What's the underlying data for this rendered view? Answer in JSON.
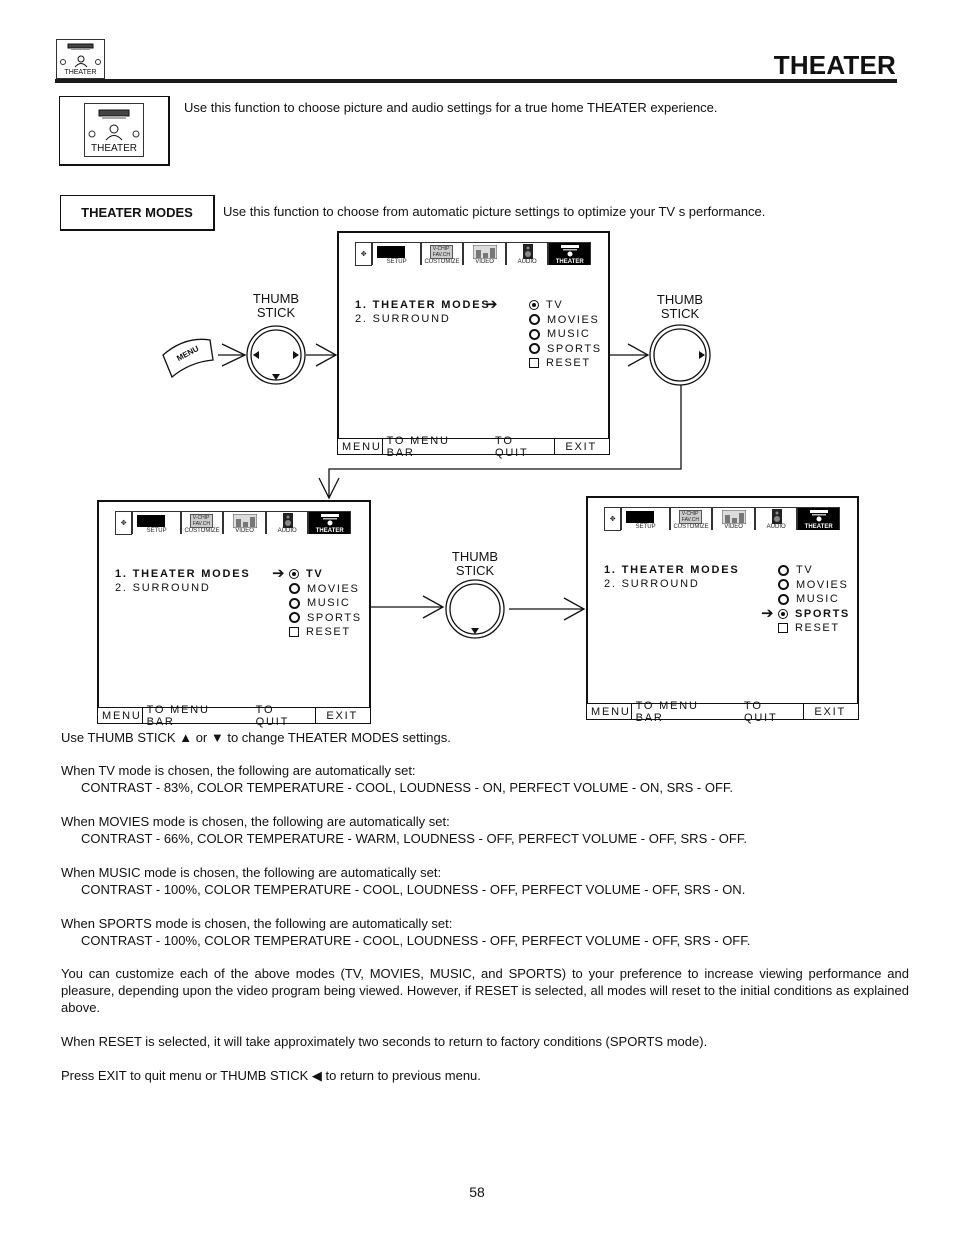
{
  "header": {
    "title": "THEATER",
    "corner_icon_label": "THEATER"
  },
  "intro": {
    "icon_label": "THEATER",
    "text": "Use this function to choose picture and audio settings for a true home THEATER experience."
  },
  "theater_modes": {
    "label": "THEATER MODES",
    "description": "Use this function to choose from automatic picture settings to optimize your TV s performance."
  },
  "diagram": {
    "menu_button_label": "MENU",
    "thumb_stick_label_line1": "THUMB",
    "thumb_stick_label_line2": "STICK",
    "menu_tabs": [
      "SETUP",
      "CUSTOMIZE",
      "VIDEO",
      "AUDIO",
      "THEATER"
    ],
    "customize_tab_lines": [
      "V-CHIP",
      "FAV.CH"
    ],
    "screens": [
      {
        "menu_items": [
          "1. THEATER MODES",
          "2. SURROUND"
        ],
        "options": [
          {
            "label": "TV",
            "type": "radio",
            "selected": true,
            "pointer": false,
            "bold": false
          },
          {
            "label": "MOVIES",
            "type": "radio",
            "selected": false,
            "pointer": false,
            "bold": false
          },
          {
            "label": "MUSIC",
            "type": "radio",
            "selected": false,
            "pointer": false,
            "bold": false
          },
          {
            "label": "SPORTS",
            "type": "radio",
            "selected": false,
            "pointer": false,
            "bold": false
          },
          {
            "label": "RESET",
            "type": "checkbox",
            "selected": false,
            "pointer": false,
            "bold": false
          }
        ],
        "pointer_on": "menu"
      },
      {
        "menu_items": [
          "1. THEATER MODES",
          "2. SURROUND"
        ],
        "options": [
          {
            "label": "TV",
            "type": "radio",
            "selected": true,
            "pointer": true,
            "bold": true
          },
          {
            "label": "MOVIES",
            "type": "radio",
            "selected": false,
            "pointer": false,
            "bold": false
          },
          {
            "label": "MUSIC",
            "type": "radio",
            "selected": false,
            "pointer": false,
            "bold": false
          },
          {
            "label": "SPORTS",
            "type": "radio",
            "selected": false,
            "pointer": false,
            "bold": false
          },
          {
            "label": "RESET",
            "type": "checkbox",
            "selected": false,
            "pointer": false,
            "bold": false
          }
        ],
        "pointer_on": "option"
      },
      {
        "menu_items": [
          "1. THEATER MODES",
          "2. SURROUND"
        ],
        "options": [
          {
            "label": "TV",
            "type": "radio",
            "selected": false,
            "pointer": false,
            "bold": false
          },
          {
            "label": "MOVIES",
            "type": "radio",
            "selected": false,
            "pointer": false,
            "bold": false
          },
          {
            "label": "MUSIC",
            "type": "radio",
            "selected": false,
            "pointer": false,
            "bold": false
          },
          {
            "label": "SPORTS",
            "type": "radio",
            "selected": true,
            "pointer": true,
            "bold": true
          },
          {
            "label": "RESET",
            "type": "checkbox",
            "selected": false,
            "pointer": false,
            "bold": false
          }
        ],
        "pointer_on": "option"
      }
    ],
    "footer": {
      "menu": "MENU",
      "to_menu_bar": "TO MENU BAR",
      "to_quit": "TO QUIT",
      "exit": "EXIT"
    }
  },
  "body": {
    "usage": "Use THUMB STICK ▲ or ▼ to change THEATER MODES settings.",
    "tv_intro": "When TV mode is chosen, the following are automatically set:",
    "tv_settings": "CONTRAST - 83%, COLOR TEMPERATURE - COOL, LOUDNESS - ON, PERFECT VOLUME - ON, SRS - OFF.",
    "movies_intro": "When MOVIES mode is chosen, the following are automatically set:",
    "movies_settings": "CONTRAST - 66%, COLOR TEMPERATURE - WARM, LOUDNESS - OFF, PERFECT VOLUME - OFF, SRS - OFF.",
    "music_intro": "When MUSIC mode is chosen, the following are automatically set:",
    "music_settings": "CONTRAST - 100%, COLOR TEMPERATURE - COOL, LOUDNESS - OFF, PERFECT VOLUME - OFF, SRS - ON.",
    "sports_intro": "When SPORTS mode is chosen, the following are automatically set:",
    "sports_settings": "CONTRAST - 100%, COLOR TEMPERATURE - COOL, LOUDNESS - OFF, PERFECT VOLUME - OFF, SRS - OFF.",
    "customize": "You can customize each of the above modes (TV, MOVIES, MUSIC, and SPORTS) to your preference to increase viewing performance and pleasure, depending upon the video program being viewed. However, if RESET is selected, all modes will reset to the initial conditions as explained above.",
    "reset": "When RESET is selected, it will take approximately two seconds to return to factory conditions (SPORTS mode).",
    "exit": "Press EXIT to quit menu or THUMB STICK ◀ to return to previous menu."
  },
  "page_number": "58"
}
